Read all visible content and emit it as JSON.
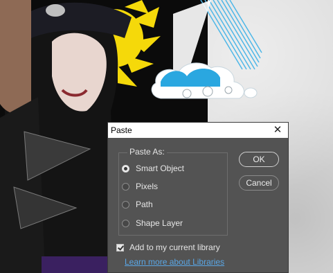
{
  "dialog": {
    "title": "Paste",
    "close_icon": "close-icon",
    "group_label": "Paste As:",
    "options": [
      {
        "label": "Smart Object",
        "selected": true
      },
      {
        "label": "Pixels",
        "selected": false
      },
      {
        "label": "Path",
        "selected": false
      },
      {
        "label": "Shape Layer",
        "selected": false
      }
    ],
    "ok_label": "OK",
    "cancel_label": "Cancel",
    "checkbox_label": "Add to my current library",
    "checkbox_checked": true,
    "link_label": "Learn more about Libraries"
  },
  "colors": {
    "dialog_bg": "#535353",
    "link": "#5aa7e6",
    "sun": "#f5d90a",
    "cloud": "#2aa7e0"
  }
}
